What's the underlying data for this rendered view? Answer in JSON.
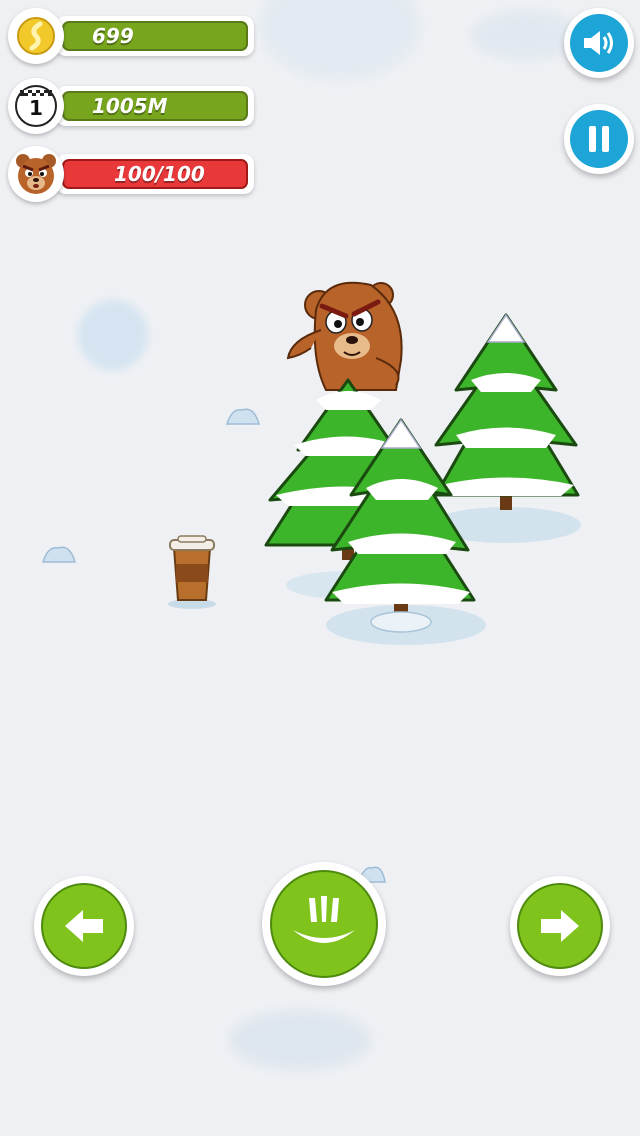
{
  "hud": {
    "coins": {
      "value": "699",
      "icon": "coin-icon"
    },
    "distance": {
      "value": "1005M",
      "rank": "1",
      "icon": "rank-flag-icon"
    },
    "health": {
      "value": "100/100",
      "icon": "bear-face-icon",
      "current": 100,
      "max": 100
    }
  },
  "buttons": {
    "sound": {
      "icon": "speaker-icon"
    },
    "pause": {
      "icon": "pause-icon"
    },
    "left": {
      "icon": "arrow-left-icon"
    },
    "attack": {
      "icon": "claw-attack-icon"
    },
    "right": {
      "icon": "arrow-right-icon"
    }
  },
  "colors": {
    "bar_green": "#77a51e",
    "bar_red": "#e8383a",
    "button_green": "#7fc31c",
    "button_blue": "#1ea5d8"
  }
}
